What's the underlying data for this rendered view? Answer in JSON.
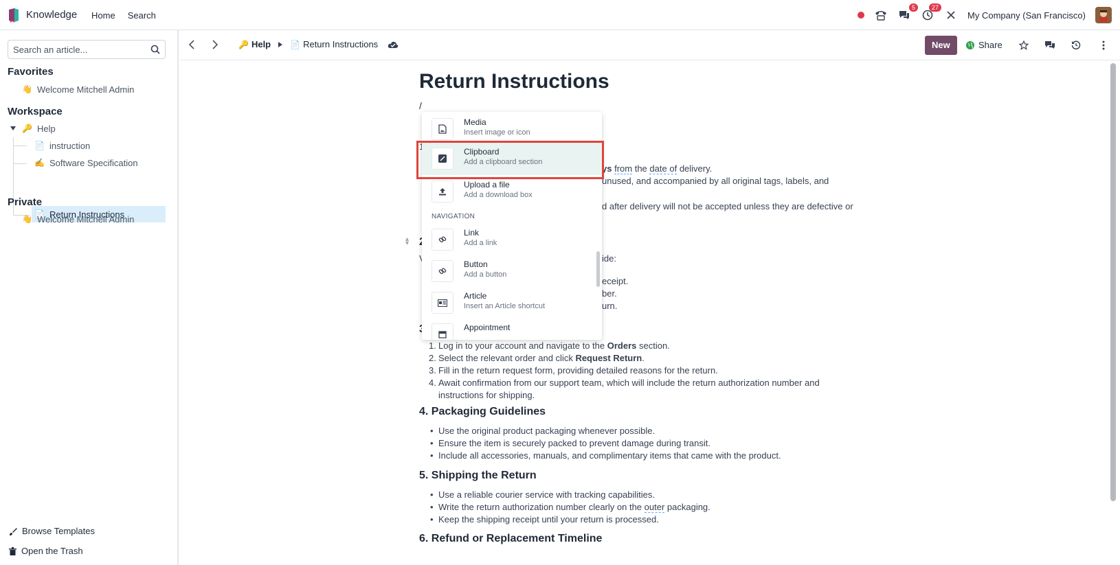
{
  "app": {
    "name": "Knowledge"
  },
  "nav": {
    "menu": [
      "Home",
      "Search"
    ],
    "badges": {
      "chat": "5",
      "activity": "27"
    },
    "company": "My Company (San Francisco)"
  },
  "sidebar": {
    "search_placeholder": "Search an article...",
    "favorites_title": "Favorites",
    "favorites": [
      {
        "emoji": "👋",
        "label": "Welcome Mitchell Admin"
      }
    ],
    "workspace_title": "Workspace",
    "workspace": {
      "root": {
        "emoji": "🔑",
        "label": "Help"
      },
      "children": [
        {
          "emoji": "📄",
          "label": "instruction"
        },
        {
          "emoji": "✍️",
          "label": "Software Specification"
        },
        {
          "emoji": "📄",
          "label": "Return Instructions"
        }
      ]
    },
    "private_title": "Private",
    "private": [
      {
        "emoji": "👋",
        "label": "Welcome Mitchell Admin"
      }
    ],
    "browse_templates": "Browse Templates",
    "open_trash": "Open the Trash"
  },
  "control": {
    "breadcrumb_parent_emoji": "🔑",
    "breadcrumb_parent": "Help",
    "breadcrumb_current_emoji": "📄",
    "breadcrumb_current": "Return Instructions",
    "new_label": "New",
    "share_label": "Share"
  },
  "article": {
    "title": "Return Instructions",
    "slash": "/",
    "line1_a": "ys",
    "line1_b": "from",
    "line1_c": "the",
    "line1_d": "date of",
    "line1_e": "delivery.",
    "line2": "unused, and accompanied by all original tags, labels, and",
    "line3": "d after delivery will not be accepted unless they are defective or",
    "frag_num1": "1",
    "frag_num2": "2",
    "frag_num3": "3",
    "frag_v": "V",
    "frag_ide": "ide:",
    "frag_receipt": "eceipt.",
    "frag_number": "ber.",
    "frag_return": "urn.",
    "section3_items": [
      {
        "pre": "Log in to your account and navigate to the ",
        "bold": "Orders",
        "post": " section."
      },
      {
        "pre": "Select the relevant order and click ",
        "bold": "Request Return",
        "post": "."
      },
      {
        "pre": "Fill in the return request form, providing detailed reasons for the return.",
        "bold": "",
        "post": ""
      },
      {
        "pre": "Await confirmation from our support team, which will include the return authorization number and",
        "bold": "",
        "post": ""
      }
    ],
    "section3_wrap": "instructions for shipping.",
    "section4_title": "4. Packaging Guidelines",
    "section4_items": [
      "Use the original product packaging whenever possible.",
      "Ensure the item is securely packed to prevent damage during transit.",
      "Include all accessories, manuals, and complimentary items that came with the product."
    ],
    "section5_title": "5. Shipping the Return",
    "section5_items": [
      "Use a reliable courier service with tracking capabilities.",
      "Keep the shipping receipt until your return is processed."
    ],
    "section5_item2_pre": "Write the return authorization number clearly on the ",
    "section5_item2_ul": "outer",
    "section5_item2_post": " packaging.",
    "section6_title": "6. Refund or Replacement Timeline"
  },
  "powerbox": {
    "items": [
      {
        "label": "Media",
        "desc": "Insert image or icon",
        "icon": "image-icon"
      },
      {
        "label": "Clipboard",
        "desc": "Add a clipboard section",
        "icon": "clipboard-icon"
      },
      {
        "label": "Upload a file",
        "desc": "Add a download box",
        "icon": "upload-icon"
      },
      {
        "label": "Link",
        "desc": "Add a link",
        "icon": "link-icon"
      },
      {
        "label": "Button",
        "desc": "Add a button",
        "icon": "link-icon"
      },
      {
        "label": "Article",
        "desc": "Insert an Article shortcut",
        "icon": "article-icon"
      },
      {
        "label": "Appointment",
        "desc": "",
        "icon": "calendar-icon"
      }
    ],
    "category_navigation": "NAVIGATION"
  },
  "colors": {
    "primary": "#714b67",
    "highlight": "#e0443c",
    "badge": "#e0394b",
    "active": "#d9eefa"
  }
}
